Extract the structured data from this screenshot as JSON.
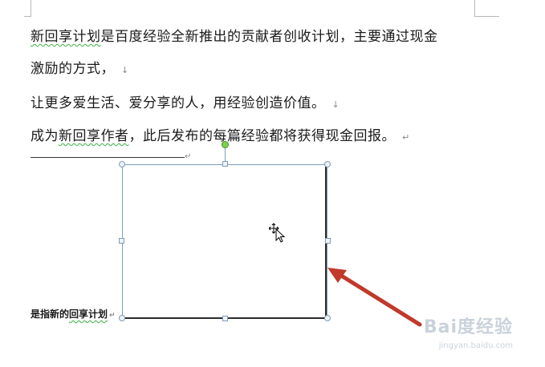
{
  "document": {
    "lines": [
      {
        "pre": "",
        "squiggle": "新回享计划",
        "post": "是百度经验全新推出的贡献者创收计划，主要通过现金",
        "mark": ""
      },
      {
        "pre": "激励的方式，",
        "squiggle": "",
        "post": "",
        "mark": "↓"
      },
      {
        "pre": "让更多爱生活、爱分享的人，用经验创造价值。",
        "squiggle": "",
        "post": "",
        "mark": "↓"
      },
      {
        "pre": "成为",
        "squiggle": "新回享作者",
        "post": "，此后发布的每篇经验都将获得现金回报。",
        "mark": "↵"
      }
    ],
    "rule_mark": "↵",
    "caption": {
      "pre": "是指新的",
      "squiggle": "回享计划",
      "mark": "↵"
    }
  },
  "watermark": {
    "brand": "Bai度经验",
    "url": "jingyan.baidu.com"
  },
  "colors": {
    "arrow": "#c0392b",
    "shape_border": "#7f9db9",
    "squiggle": "#3cb043",
    "rotate_handle": "#7fd14a"
  }
}
